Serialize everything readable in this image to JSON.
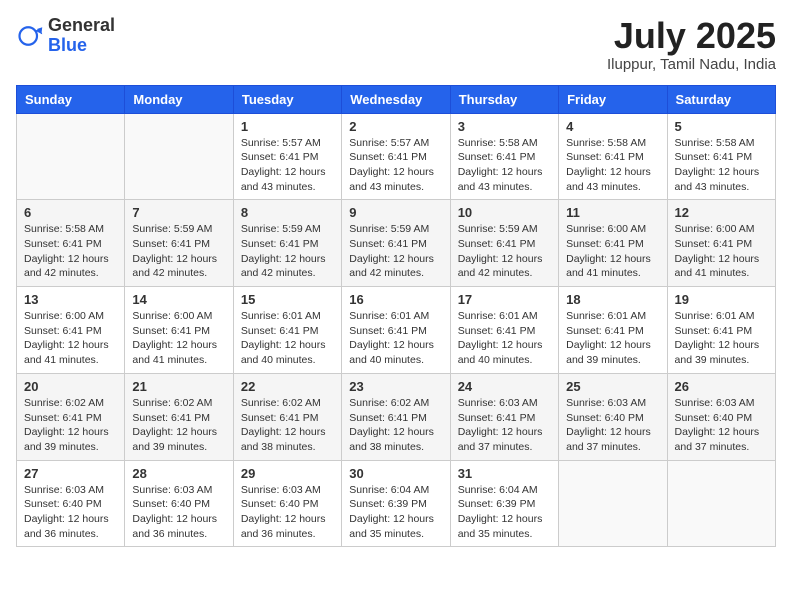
{
  "logo": {
    "general": "General",
    "blue": "Blue"
  },
  "title": "July 2025",
  "location": "Iluppur, Tamil Nadu, India",
  "headers": [
    "Sunday",
    "Monday",
    "Tuesday",
    "Wednesday",
    "Thursday",
    "Friday",
    "Saturday"
  ],
  "weeks": [
    [
      {
        "day": "",
        "info": ""
      },
      {
        "day": "",
        "info": ""
      },
      {
        "day": "1",
        "info": "Sunrise: 5:57 AM\nSunset: 6:41 PM\nDaylight: 12 hours and 43 minutes."
      },
      {
        "day": "2",
        "info": "Sunrise: 5:57 AM\nSunset: 6:41 PM\nDaylight: 12 hours and 43 minutes."
      },
      {
        "day": "3",
        "info": "Sunrise: 5:58 AM\nSunset: 6:41 PM\nDaylight: 12 hours and 43 minutes."
      },
      {
        "day": "4",
        "info": "Sunrise: 5:58 AM\nSunset: 6:41 PM\nDaylight: 12 hours and 43 minutes."
      },
      {
        "day": "5",
        "info": "Sunrise: 5:58 AM\nSunset: 6:41 PM\nDaylight: 12 hours and 43 minutes."
      }
    ],
    [
      {
        "day": "6",
        "info": "Sunrise: 5:58 AM\nSunset: 6:41 PM\nDaylight: 12 hours and 42 minutes."
      },
      {
        "day": "7",
        "info": "Sunrise: 5:59 AM\nSunset: 6:41 PM\nDaylight: 12 hours and 42 minutes."
      },
      {
        "day": "8",
        "info": "Sunrise: 5:59 AM\nSunset: 6:41 PM\nDaylight: 12 hours and 42 minutes."
      },
      {
        "day": "9",
        "info": "Sunrise: 5:59 AM\nSunset: 6:41 PM\nDaylight: 12 hours and 42 minutes."
      },
      {
        "day": "10",
        "info": "Sunrise: 5:59 AM\nSunset: 6:41 PM\nDaylight: 12 hours and 42 minutes."
      },
      {
        "day": "11",
        "info": "Sunrise: 6:00 AM\nSunset: 6:41 PM\nDaylight: 12 hours and 41 minutes."
      },
      {
        "day": "12",
        "info": "Sunrise: 6:00 AM\nSunset: 6:41 PM\nDaylight: 12 hours and 41 minutes."
      }
    ],
    [
      {
        "day": "13",
        "info": "Sunrise: 6:00 AM\nSunset: 6:41 PM\nDaylight: 12 hours and 41 minutes."
      },
      {
        "day": "14",
        "info": "Sunrise: 6:00 AM\nSunset: 6:41 PM\nDaylight: 12 hours and 41 minutes."
      },
      {
        "day": "15",
        "info": "Sunrise: 6:01 AM\nSunset: 6:41 PM\nDaylight: 12 hours and 40 minutes."
      },
      {
        "day": "16",
        "info": "Sunrise: 6:01 AM\nSunset: 6:41 PM\nDaylight: 12 hours and 40 minutes."
      },
      {
        "day": "17",
        "info": "Sunrise: 6:01 AM\nSunset: 6:41 PM\nDaylight: 12 hours and 40 minutes."
      },
      {
        "day": "18",
        "info": "Sunrise: 6:01 AM\nSunset: 6:41 PM\nDaylight: 12 hours and 39 minutes."
      },
      {
        "day": "19",
        "info": "Sunrise: 6:01 AM\nSunset: 6:41 PM\nDaylight: 12 hours and 39 minutes."
      }
    ],
    [
      {
        "day": "20",
        "info": "Sunrise: 6:02 AM\nSunset: 6:41 PM\nDaylight: 12 hours and 39 minutes."
      },
      {
        "day": "21",
        "info": "Sunrise: 6:02 AM\nSunset: 6:41 PM\nDaylight: 12 hours and 39 minutes."
      },
      {
        "day": "22",
        "info": "Sunrise: 6:02 AM\nSunset: 6:41 PM\nDaylight: 12 hours and 38 minutes."
      },
      {
        "day": "23",
        "info": "Sunrise: 6:02 AM\nSunset: 6:41 PM\nDaylight: 12 hours and 38 minutes."
      },
      {
        "day": "24",
        "info": "Sunrise: 6:03 AM\nSunset: 6:41 PM\nDaylight: 12 hours and 37 minutes."
      },
      {
        "day": "25",
        "info": "Sunrise: 6:03 AM\nSunset: 6:40 PM\nDaylight: 12 hours and 37 minutes."
      },
      {
        "day": "26",
        "info": "Sunrise: 6:03 AM\nSunset: 6:40 PM\nDaylight: 12 hours and 37 minutes."
      }
    ],
    [
      {
        "day": "27",
        "info": "Sunrise: 6:03 AM\nSunset: 6:40 PM\nDaylight: 12 hours and 36 minutes."
      },
      {
        "day": "28",
        "info": "Sunrise: 6:03 AM\nSunset: 6:40 PM\nDaylight: 12 hours and 36 minutes."
      },
      {
        "day": "29",
        "info": "Sunrise: 6:03 AM\nSunset: 6:40 PM\nDaylight: 12 hours and 36 minutes."
      },
      {
        "day": "30",
        "info": "Sunrise: 6:04 AM\nSunset: 6:39 PM\nDaylight: 12 hours and 35 minutes."
      },
      {
        "day": "31",
        "info": "Sunrise: 6:04 AM\nSunset: 6:39 PM\nDaylight: 12 hours and 35 minutes."
      },
      {
        "day": "",
        "info": ""
      },
      {
        "day": "",
        "info": ""
      }
    ]
  ]
}
